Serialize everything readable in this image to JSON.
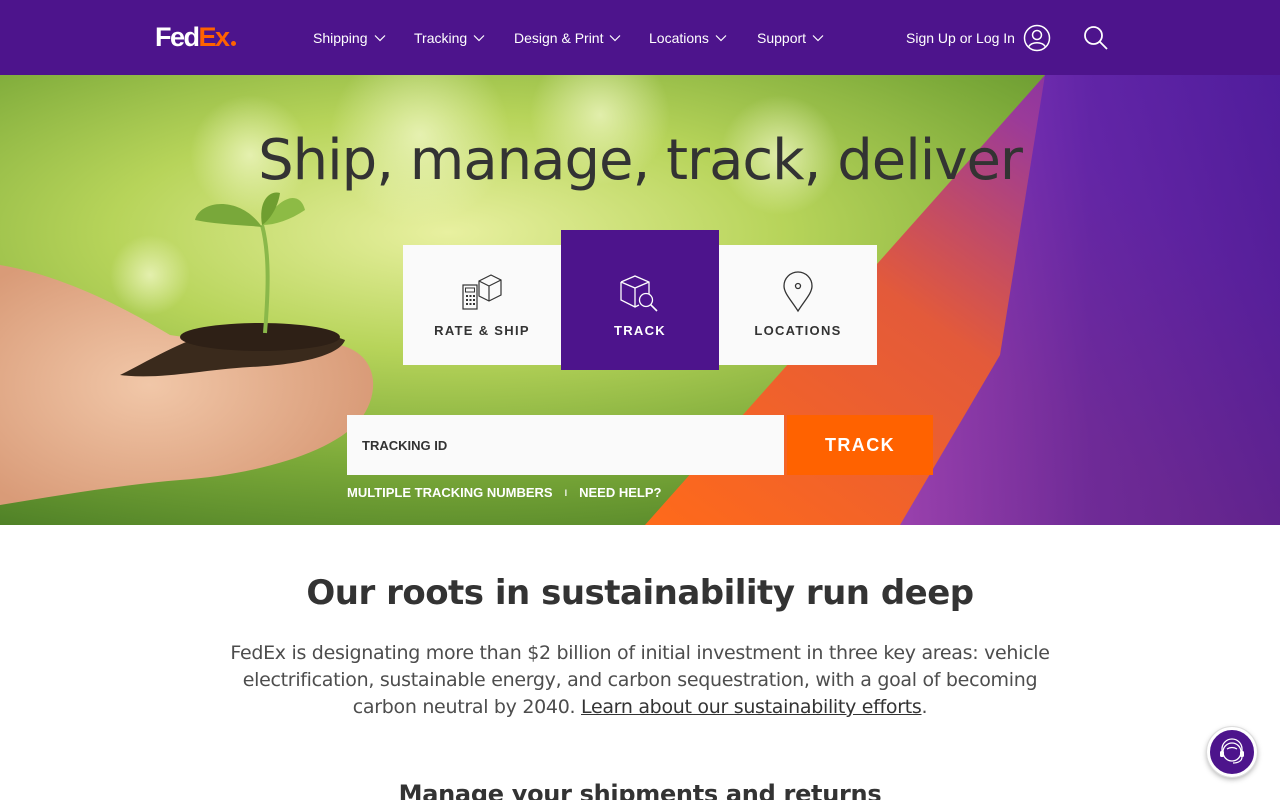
{
  "header": {
    "logo": {
      "fed": "Fed",
      "ex": "Ex"
    },
    "nav": [
      {
        "label": "Shipping"
      },
      {
        "label": "Tracking"
      },
      {
        "label": "Design & Print"
      },
      {
        "label": "Locations"
      },
      {
        "label": "Support"
      }
    ],
    "signin_label": "Sign Up or Log In"
  },
  "hero": {
    "title": "Ship, manage, track, deliver",
    "tiles": [
      {
        "label": "RATE & SHIP",
        "icon": "calculator-box-icon",
        "active": false
      },
      {
        "label": "TRACK",
        "icon": "package-search-icon",
        "active": true
      },
      {
        "label": "LOCATIONS",
        "icon": "location-pin-icon",
        "active": false
      }
    ],
    "tracking_placeholder": "TRACKING ID",
    "track_button": "TRACK",
    "links": {
      "multiple": "MULTIPLE TRACKING NUMBERS",
      "separator": "I",
      "help": "NEED HELP?"
    }
  },
  "sustainability": {
    "title": "Our roots in sustainability run deep",
    "body": "FedEx is designating more than $2 billion of initial investment in three key areas: vehicle electrification, sustainable energy, and carbon sequestration, with a goal of becoming carbon neutral by 2040. ",
    "link": "Learn about our sustainability efforts",
    "end": "."
  },
  "next_section": {
    "title": "Manage your shipments and returns"
  },
  "colors": {
    "brand_purple": "#4d148c",
    "brand_orange": "#ff6200"
  }
}
